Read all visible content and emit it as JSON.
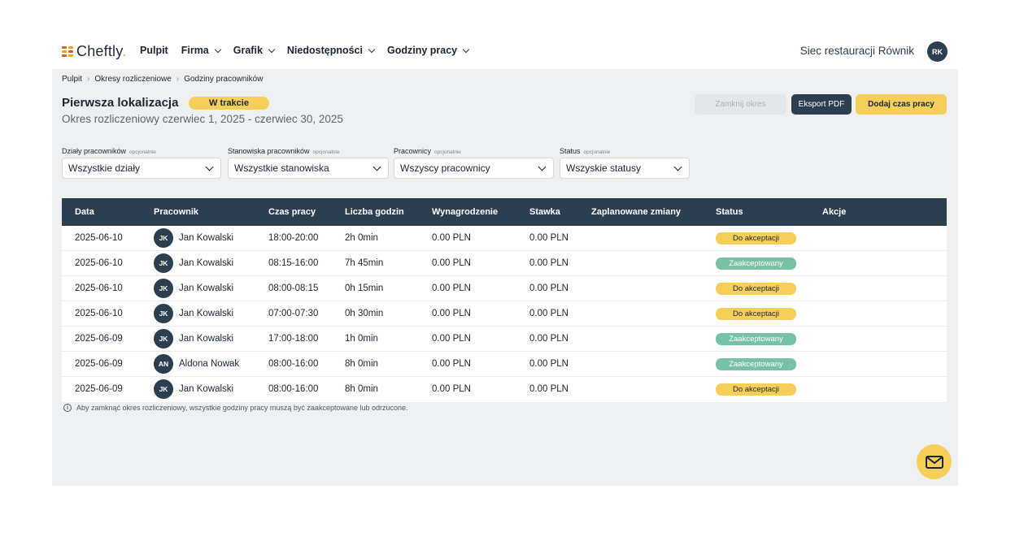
{
  "brand": {
    "name": "Cheftly",
    "dot": "."
  },
  "nav": [
    {
      "label": "Pulpit",
      "dropdown": false
    },
    {
      "label": "Firma",
      "dropdown": true
    },
    {
      "label": "Grafik",
      "dropdown": true
    },
    {
      "label": "Niedostępności",
      "dropdown": true
    },
    {
      "label": "Godziny pracy",
      "dropdown": true
    }
  ],
  "org": {
    "name": "Siec restauracji Równik",
    "initials": "RK"
  },
  "breadcrumb": [
    "Pulpit",
    "Okresy rozliczeniowe",
    "Godziny pracowników"
  ],
  "page": {
    "title": "Pierwsza lokalizacja",
    "status": "W trakcie",
    "subtitle": "Okres rozliczeniowy czerwiec 1, 2025 - czerwiec 30, 2025"
  },
  "buttons": {
    "close": "Zamknij okres",
    "export": "Eksport PDF",
    "add": "Dodaj czas pracy"
  },
  "filters": [
    {
      "label": "Działy pracowników",
      "optional": "opcjonalnie",
      "value": "Wszystkie działy"
    },
    {
      "label": "Stanowiska pracowników",
      "optional": "opcjonalnie",
      "value": "Wszystkie stanowiska"
    },
    {
      "label": "Pracownicy",
      "optional": "opcjonalnie",
      "value": "Wszyscy pracownicy"
    },
    {
      "label": "Status",
      "optional": "opcjonalnie",
      "value": "Wszyskie statusy"
    }
  ],
  "table": {
    "headers": [
      "Data",
      "Pracownik",
      "Czas pracy",
      "Liczba godzin",
      "Wynagrodzenie",
      "Stawka",
      "Zaplanowane zmiany",
      "Status",
      "Akcje"
    ],
    "rows": [
      {
        "date": "2025-06-10",
        "initials": "JK",
        "name": "Jan Kowalski",
        "time": "18:00-20:00",
        "hours": "2h 0min",
        "pay": "0.00 PLN",
        "rate": "0.00 PLN",
        "status": "Do akceptacji",
        "kind": "pending"
      },
      {
        "date": "2025-06-10",
        "initials": "JK",
        "name": "Jan Kowalski",
        "time": "08:15-16:00",
        "hours": "7h 45min",
        "pay": "0.00 PLN",
        "rate": "0.00 PLN",
        "status": "Zaakceptowany",
        "kind": "accepted"
      },
      {
        "date": "2025-06-10",
        "initials": "JK",
        "name": "Jan Kowalski",
        "time": "08:00-08:15",
        "hours": "0h 15min",
        "pay": "0.00 PLN",
        "rate": "0.00 PLN",
        "status": "Do akceptacji",
        "kind": "pending"
      },
      {
        "date": "2025-06-10",
        "initials": "JK",
        "name": "Jan Kowalski",
        "time": "07:00-07:30",
        "hours": "0h 30min",
        "pay": "0.00 PLN",
        "rate": "0.00 PLN",
        "status": "Do akceptacji",
        "kind": "pending"
      },
      {
        "date": "2025-06-09",
        "initials": "JK",
        "name": "Jan Kowalski",
        "time": "17:00-18:00",
        "hours": "1h 0min",
        "pay": "0.00 PLN",
        "rate": "0.00 PLN",
        "status": "Zaakceptowany",
        "kind": "accepted"
      },
      {
        "date": "2025-06-09",
        "initials": "AN",
        "name": "Aldona Nowak",
        "time": "08:00-16:00",
        "hours": "8h 0min",
        "pay": "0.00 PLN",
        "rate": "0.00 PLN",
        "status": "Zaakceptowany",
        "kind": "accepted"
      },
      {
        "date": "2025-06-09",
        "initials": "JK",
        "name": "Jan Kowalski",
        "time": "08:00-16:00",
        "hours": "8h 0min",
        "pay": "0.00 PLN",
        "rate": "0.00 PLN",
        "status": "Do akceptacji",
        "kind": "pending"
      }
    ]
  },
  "note": "Aby zamknąć okres rozliczeniowy, wszystkie godziny pracy muszą być zaakceptowane lub odrzucone.",
  "colors": {
    "navy": "#2d3e4f",
    "yellow": "#f6cf5b",
    "green": "#78c2a4",
    "background": "#eef0f2"
  },
  "icons": {
    "fab": "mail-icon",
    "note": "info-icon"
  }
}
